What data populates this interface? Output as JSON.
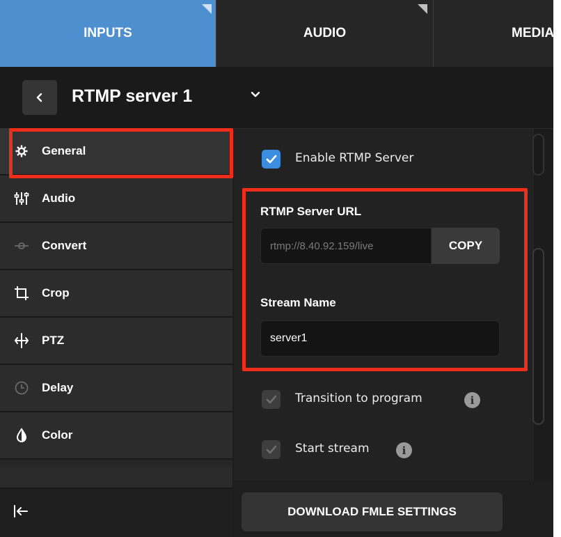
{
  "tabs": [
    {
      "label": "INPUTS",
      "active": true
    },
    {
      "label": "AUDIO",
      "active": false
    },
    {
      "label": "MEDIA",
      "active": false
    }
  ],
  "header": {
    "title": "RTMP server 1"
  },
  "sidebar": {
    "items": [
      {
        "label": "General",
        "icon": "gear-icon",
        "active": true
      },
      {
        "label": "Audio",
        "icon": "audio-mixer-icon"
      },
      {
        "label": "Convert",
        "icon": "convert-icon"
      },
      {
        "label": "Crop",
        "icon": "crop-icon"
      },
      {
        "label": "PTZ",
        "icon": "ptz-icon"
      },
      {
        "label": "Delay",
        "icon": "clock-icon"
      },
      {
        "label": "Color",
        "icon": "color-drop-icon"
      }
    ]
  },
  "settings": {
    "enable_server": {
      "label": "Enable RTMP Server",
      "checked": true
    },
    "server_url": {
      "label": "RTMP Server URL",
      "value": "rtmp://8.40.92.159/live",
      "copy_label": "COPY"
    },
    "stream_name": {
      "label": "Stream Name",
      "value": "server1"
    },
    "transition": {
      "label": "Transition to program",
      "checked": true
    },
    "start_stream": {
      "label": "Start stream",
      "checked": true
    }
  },
  "footer": {
    "download_label": "DOWNLOAD FMLE SETTINGS"
  },
  "colors": {
    "accent": "#4e8fcf",
    "checkbox_on": "#3b8ddf",
    "highlight": "#ee2d1a"
  }
}
